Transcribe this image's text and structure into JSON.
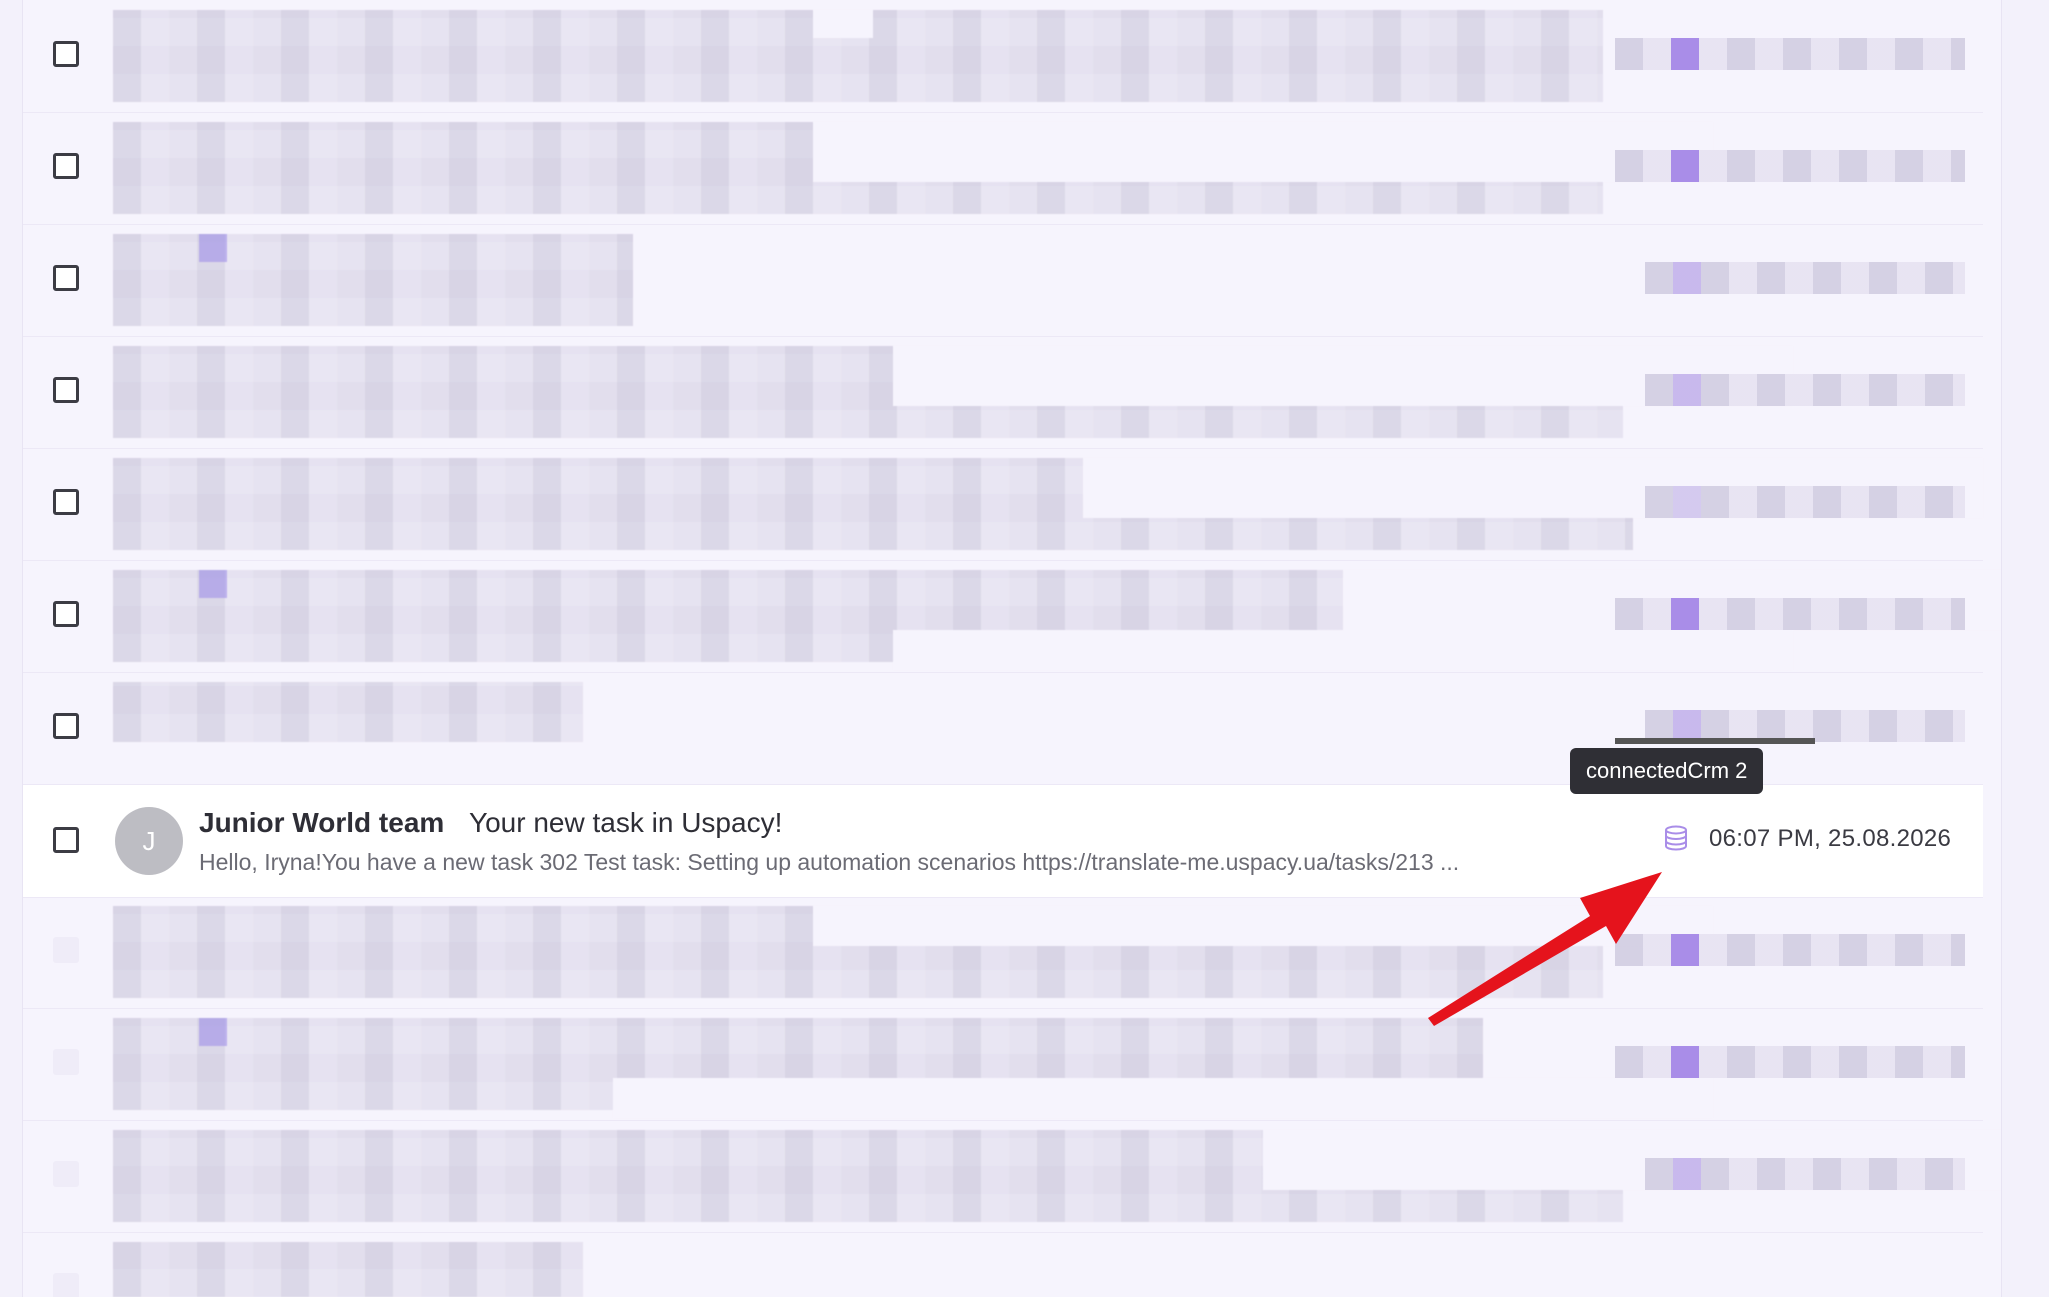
{
  "selected_message": {
    "avatar_initial": "J",
    "sender": "Junior World team",
    "subject": "Your new task in Uspacy!",
    "snippet": "Hello, Iryna!You have a new task 302 Test task: Setting up automation scenarios https://translate-me.uspacy.ua/tasks/213 ...",
    "date": "06:07 PM, 25.08.2026",
    "crm_icon": "database-icon"
  },
  "tooltip": {
    "text": "connectedCrm 2"
  },
  "colors": {
    "accent": "#a98de8",
    "annotation_arrow": "#e5131c"
  }
}
